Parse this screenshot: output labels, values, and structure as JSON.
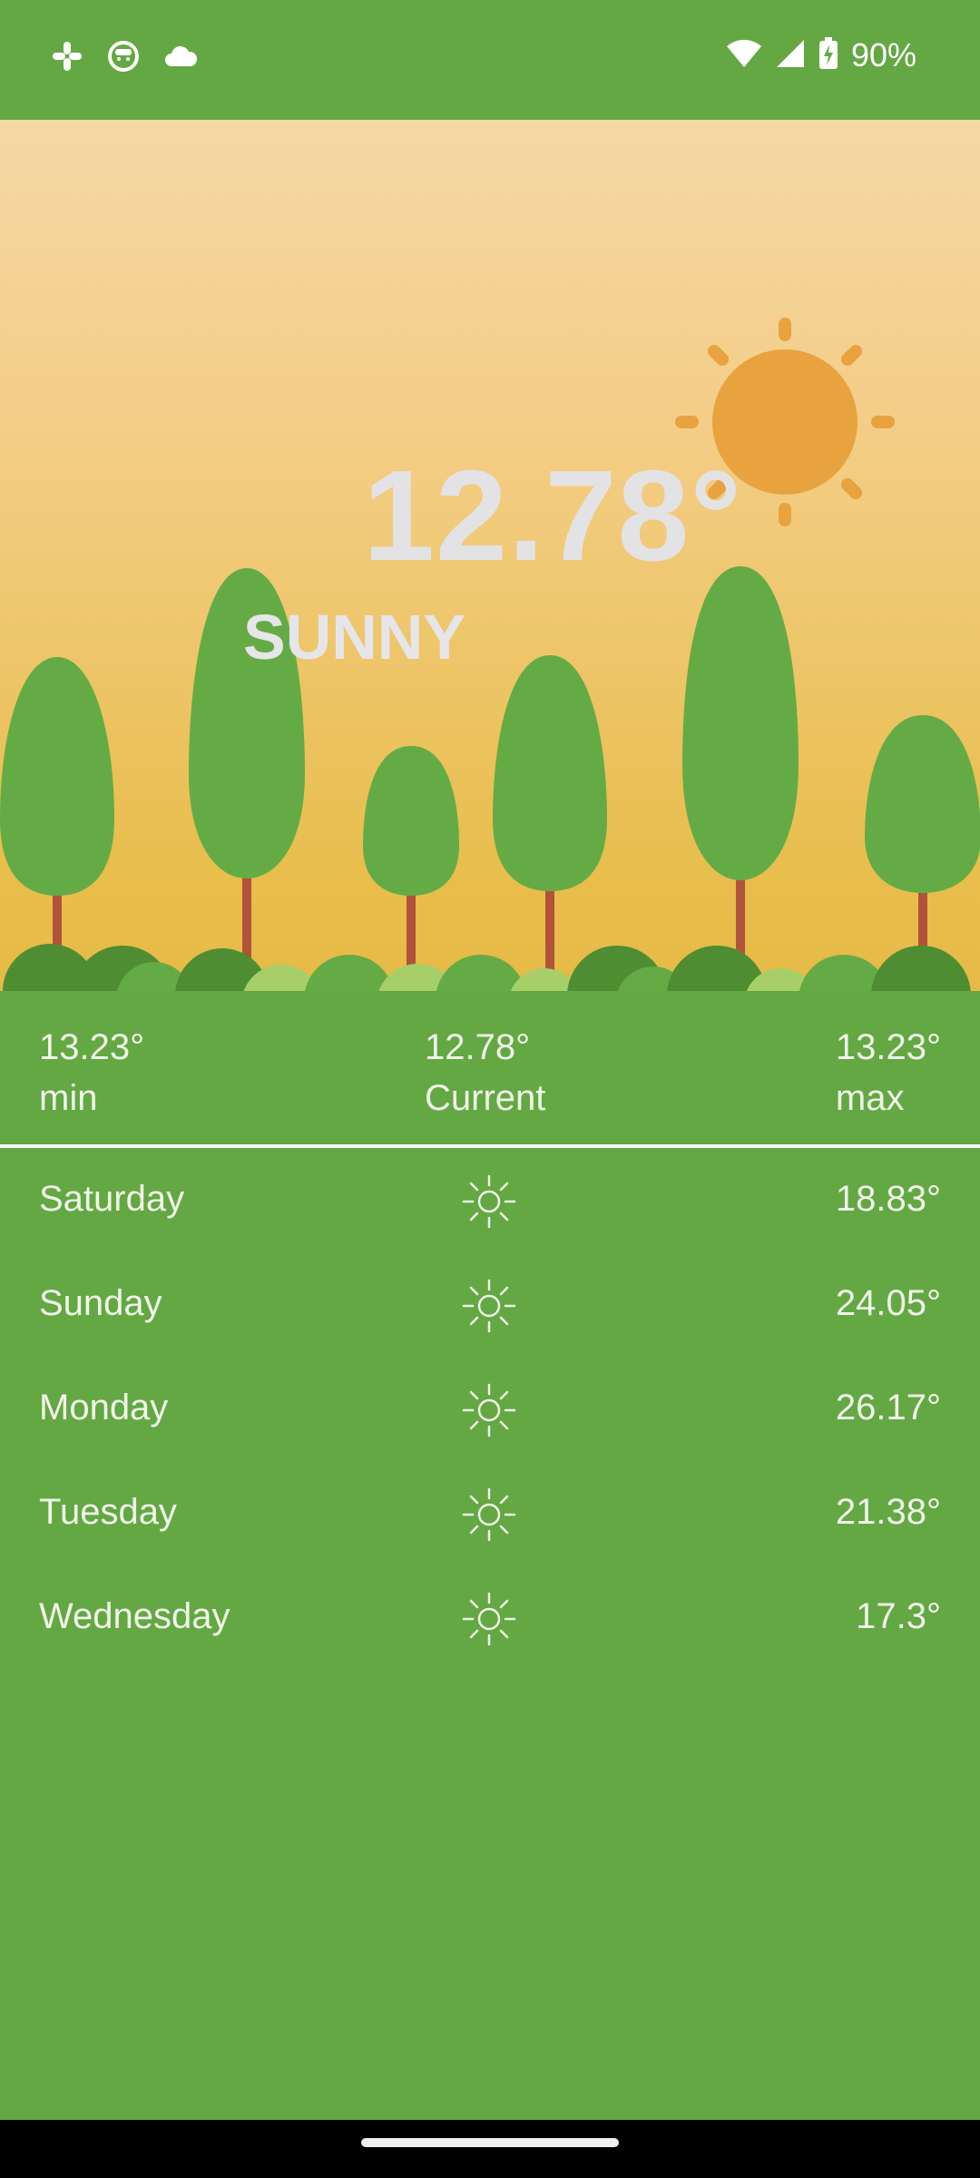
{
  "status_bar": {
    "icons": [
      "slack-icon",
      "cat-face-icon",
      "cloud-icon",
      "wifi-icon",
      "cell-signal-icon",
      "battery-charging-icon"
    ],
    "battery_percent": "90%"
  },
  "hero": {
    "current_temp": "12.78°",
    "condition": "SUNNY"
  },
  "summary": {
    "min_value": "13.23°",
    "min_label": "min",
    "current_value": "12.78°",
    "current_label": "Current",
    "max_value": "13.23°",
    "max_label": "max"
  },
  "forecast": [
    {
      "day": "Saturday",
      "icon": "sun-icon",
      "temp": "18.83°"
    },
    {
      "day": "Sunday",
      "icon": "sun-icon",
      "temp": "24.05°"
    },
    {
      "day": "Monday",
      "icon": "sun-icon",
      "temp": "26.17°"
    },
    {
      "day": "Tuesday",
      "icon": "sun-icon",
      "temp": "21.38°"
    },
    {
      "day": "Wednesday",
      "icon": "sun-icon",
      "temp": "17.3°"
    }
  ],
  "colors": {
    "background": "#63a843",
    "sun": "#e8a23e",
    "tree": "#65ab45",
    "trunk": "#b0533a",
    "sky_top": "#f6d8a6",
    "sky_bottom": "#e6ba46"
  }
}
